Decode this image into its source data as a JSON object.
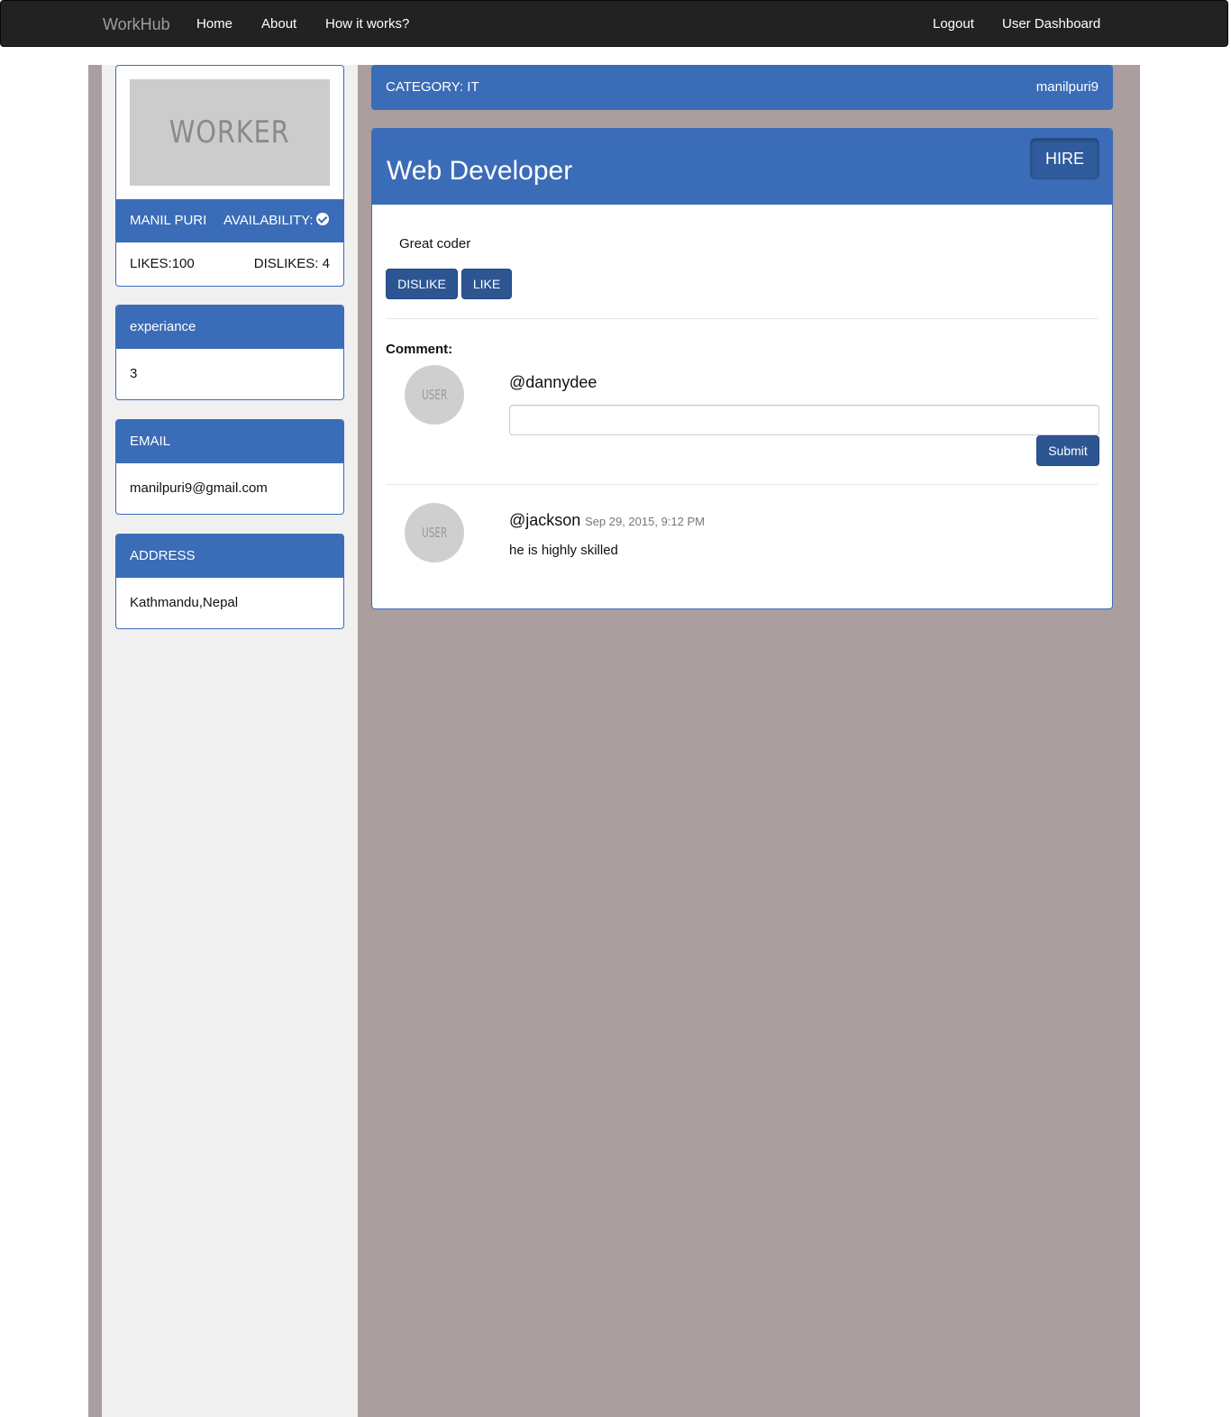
{
  "navbar": {
    "brand": "WorkHub",
    "left_links": [
      "Home",
      "About",
      "How it works?"
    ],
    "right_links": [
      "Logout",
      "User Dashboard"
    ]
  },
  "profile": {
    "photo_text": "WORKER",
    "name": "MANIL PURI",
    "availability_label": "AVAILABILITY:",
    "availability_icon": "check-circle-icon",
    "likes": "LIKES:100",
    "dislikes": "DISLIKES: 4"
  },
  "experience": {
    "label": "experiance",
    "value": "3"
  },
  "email": {
    "label": "EMAIL",
    "value": "manilpuri9@gmail.com"
  },
  "address": {
    "label": "ADDRESS",
    "value": "Kathmandu,Nepal"
  },
  "category_bar": {
    "category": "CATEGORY: IT",
    "username": "manilpuri9"
  },
  "job": {
    "title": "Web Developer",
    "hire_label": "HIRE",
    "description": "Great coder",
    "dislike_label": "DISLIKE",
    "like_label": "LIKE"
  },
  "comments": {
    "heading": "Comment:",
    "avatar_text": "USER",
    "current_user": "@dannydee",
    "input_value": "",
    "submit_label": "Submit",
    "items": [
      {
        "user": "@jackson",
        "date": "Sep 29, 2015, 9:12 PM",
        "text": "he is highly skilled"
      }
    ]
  },
  "colors": {
    "navbar_bg": "#222222",
    "panel_blue": "#3b6cb7",
    "button_blue": "#2c5592",
    "frame_bg": "#aa9e9e",
    "sidebar_bg": "#f0f0f0"
  }
}
